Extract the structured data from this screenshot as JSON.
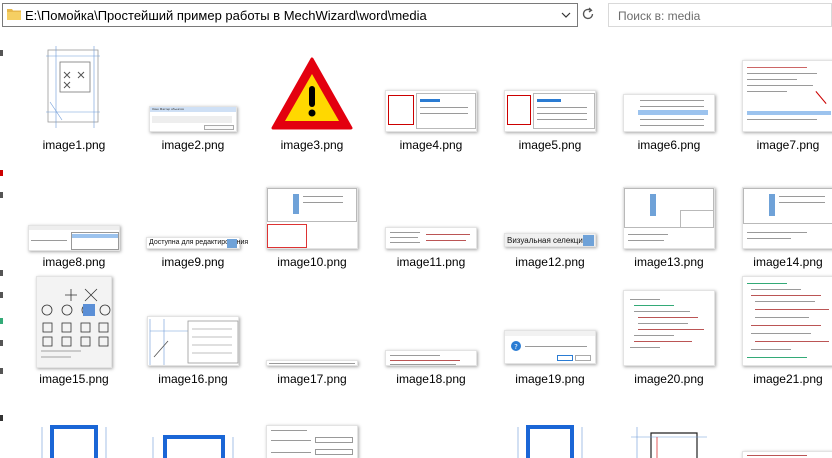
{
  "address": {
    "path": "E:\\Помойка\\Простейший пример работы в MechWizard\\word\\media"
  },
  "search": {
    "placeholder": "Поиск в: media"
  },
  "files": [
    {
      "name": "image1.png"
    },
    {
      "name": "image2.png"
    },
    {
      "name": "image3.png"
    },
    {
      "name": "image4.png"
    },
    {
      "name": "image5.png"
    },
    {
      "name": "image6.png"
    },
    {
      "name": "image7.png"
    },
    {
      "name": "image8.png"
    },
    {
      "name": "image9.png"
    },
    {
      "name": "image10.png"
    },
    {
      "name": "image11.png"
    },
    {
      "name": "image12.png"
    },
    {
      "name": "image13.png"
    },
    {
      "name": "image14.png"
    },
    {
      "name": "image15.png"
    },
    {
      "name": "image16.png"
    },
    {
      "name": "image17.png"
    },
    {
      "name": "image18.png"
    },
    {
      "name": "image19.png"
    },
    {
      "name": "image20.png"
    },
    {
      "name": "image21.png"
    }
  ],
  "thumb_text": {
    "image2_title": "Окно Мастер объектов",
    "image9_text": "Доступна для редактирования",
    "image12_text": "Визуальная селекция"
  },
  "colors": {
    "accent": "#2b7cd3",
    "warning_red": "#e3000f",
    "warning_yellow": "#ffd800"
  }
}
